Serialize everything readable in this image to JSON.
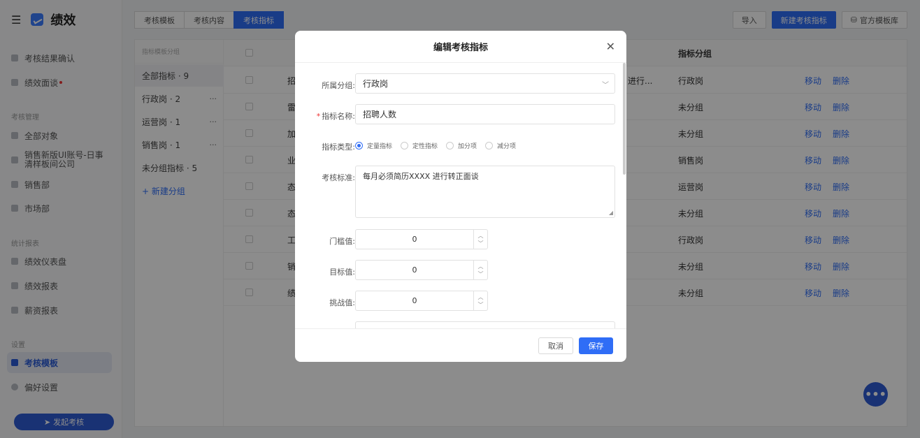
{
  "app": {
    "menu_icon": "hamburger-icon",
    "logo_icon": "chart-logo-icon",
    "title": "绩效"
  },
  "sidebar": {
    "items_top": [
      {
        "label": "考核结果确认",
        "icon": "stamp-icon"
      },
      {
        "label": "绩效面谈",
        "icon": "chat-icon"
      }
    ],
    "section_manage": "考核管理",
    "items_manage": [
      {
        "label": "全部对象",
        "icon": "grid-icon"
      },
      {
        "label": "销售新版UI账号-日事清样板间公司",
        "icon": "org-icon"
      },
      {
        "label": "销售部",
        "icon": "org-icon"
      },
      {
        "label": "市场部",
        "icon": "org-icon"
      }
    ],
    "section_report": "统计报表",
    "items_report": [
      {
        "label": "绩效仪表盘",
        "icon": "dashboard-icon"
      },
      {
        "label": "绩效报表",
        "icon": "report-icon"
      },
      {
        "label": "薪资报表",
        "icon": "salary-icon"
      }
    ],
    "section_settings": "设置",
    "items_settings": [
      {
        "label": "考核模板",
        "icon": "template-icon"
      },
      {
        "label": "偏好设置",
        "icon": "gear-icon"
      }
    ],
    "launch_button": "发起考核"
  },
  "tabs": [
    "考核模板",
    "考核内容",
    "考核指标"
  ],
  "top_actions": {
    "import": "导入",
    "new_indicator": "新建考核指标",
    "template_lib": "官方模板库"
  },
  "groups": {
    "header": "指标模板分组",
    "items": [
      {
        "label": "全部指标 · 9"
      },
      {
        "label": "行政岗 · 2",
        "more": "···"
      },
      {
        "label": "运营岗 · 1",
        "more": "···"
      },
      {
        "label": "销售岗 · 1",
        "more": "···"
      },
      {
        "label": "未分组指标 · 5"
      }
    ],
    "new_group": "+ 新建分组"
  },
  "table": {
    "col_group": "指标分组",
    "rows": [
      {
        "name": "招",
        "std": "进行...",
        "group": "行政岗"
      },
      {
        "name": "雷",
        "group": "未分组"
      },
      {
        "name": "加",
        "group": "未分组"
      },
      {
        "name": "业",
        "group": "销售岗"
      },
      {
        "name": "态",
        "group": "运营岗"
      },
      {
        "name": "态",
        "group": "未分组"
      },
      {
        "name": "工",
        "group": "行政岗"
      },
      {
        "name": "销",
        "group": "未分组"
      },
      {
        "name": "绩",
        "group": "未分组"
      }
    ],
    "move_label": "移动",
    "delete_label": "删除"
  },
  "modal": {
    "title": "编辑考核指标",
    "fields": {
      "group_label": "所属分组:",
      "group_value": "行政岗",
      "name_required": "*",
      "name_label": "指标名称:",
      "name_value": "招聘人数",
      "type_label": "指标类型:",
      "type_options": [
        "定量指标",
        "定性指标",
        "加分项",
        "减分项"
      ],
      "standard_label": "考核标准:",
      "standard_value": "每月必须简历XXXX 进行转正面谈",
      "threshold_label": "门槛值:",
      "threshold_value": "0",
      "target_label": "目标值:",
      "target_value": "0",
      "challenge_label": "挑战值:",
      "challenge_value": "0"
    },
    "cancel": "取消",
    "save": "保存"
  },
  "colors": {
    "primary": "#2f6df6",
    "sidebar_active": "#2a5bd7",
    "required": "#e33333"
  }
}
